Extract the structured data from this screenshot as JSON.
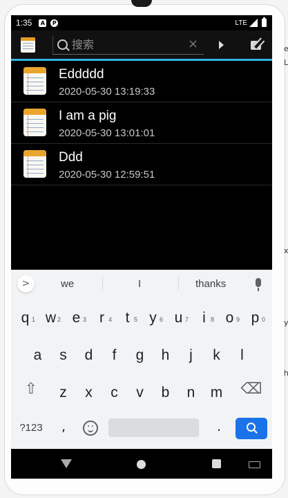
{
  "status_bar": {
    "time": "1:35",
    "network": "LTE",
    "indicator_icons": [
      "A",
      "P"
    ]
  },
  "toolbar": {
    "search_placeholder": "搜索",
    "clear_symbol": "×"
  },
  "notes": [
    {
      "title": "Eddddd",
      "timestamp": "2020-05-30 13:19:33"
    },
    {
      "title": "I am a pig",
      "timestamp": "2020-05-30 13:01:01"
    },
    {
      "title": "Ddd",
      "timestamp": "2020-05-30 12:59:51"
    }
  ],
  "keyboard": {
    "expand_symbol": ">",
    "suggestions": [
      "we",
      "I",
      "thanks"
    ],
    "row1": [
      {
        "char": "q",
        "hint": "1"
      },
      {
        "char": "w",
        "hint": "2"
      },
      {
        "char": "e",
        "hint": "3"
      },
      {
        "char": "r",
        "hint": "4"
      },
      {
        "char": "t",
        "hint": "5"
      },
      {
        "char": "y",
        "hint": "6"
      },
      {
        "char": "u",
        "hint": "7"
      },
      {
        "char": "i",
        "hint": "8"
      },
      {
        "char": "o",
        "hint": "9"
      },
      {
        "char": "p",
        "hint": "0"
      }
    ],
    "row2": [
      "a",
      "s",
      "d",
      "f",
      "g",
      "h",
      "j",
      "k",
      "l"
    ],
    "row3": [
      "z",
      "x",
      "c",
      "v",
      "b",
      "n",
      "m"
    ],
    "shift_symbol": "⇧",
    "delete_symbol": "⌫",
    "symbols_label": "?123",
    "comma": ",",
    "period": "."
  },
  "side_text": {
    "top_1": "e",
    "top_2": "L",
    "mid_1": "x",
    "mid_2": "y",
    "bottom": "h"
  }
}
